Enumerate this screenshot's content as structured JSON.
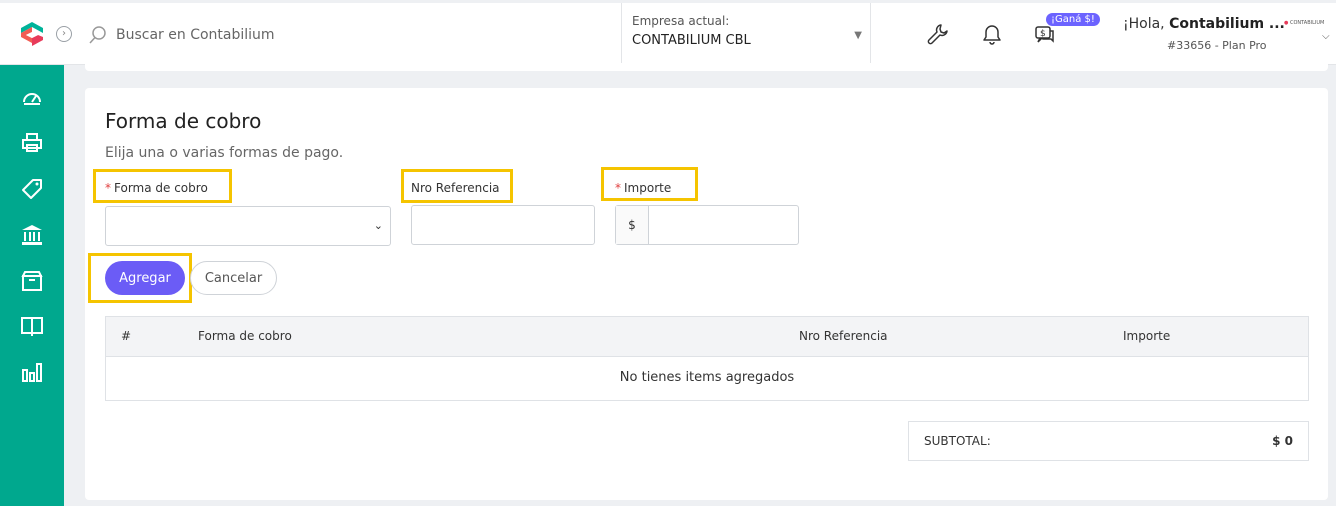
{
  "header": {
    "search_placeholder": "Buscar en Contabilium",
    "company_label": "Empresa actual:",
    "company_value": "CONTABILIUM CBL",
    "badge": "¡Ganá $!",
    "greeting_prefix": "¡Hola, ",
    "greeting_name": "Contabilium ...",
    "plan": "#33656 - Plan Pro",
    "avatar_text": "CONTABILIUM"
  },
  "colors": {
    "sidebar": "#00a88e",
    "primary_button": "#6b5cf6",
    "highlight": "#f5c400",
    "required": "#e03e3e"
  },
  "sidebar": {
    "items": [
      {
        "icon": "dashboard-icon"
      },
      {
        "icon": "printer-icon"
      },
      {
        "icon": "tag-icon"
      },
      {
        "icon": "bank-icon"
      },
      {
        "icon": "box-icon"
      },
      {
        "icon": "book-icon"
      },
      {
        "icon": "bar-chart-icon"
      }
    ]
  },
  "form": {
    "title": "Forma de cobro",
    "subtitle": "Elija una o varias formas de pago.",
    "payment_method_label": "Forma de cobro",
    "reference_label": "Nro Referencia",
    "amount_label": "Importe",
    "currency_symbol": "$",
    "required_mark": "*",
    "add_button": "Agregar",
    "cancel_button": "Cancelar"
  },
  "table": {
    "columns": [
      "#",
      "Forma de cobro",
      "Nro Referencia",
      "Importe"
    ],
    "empty_message": "No tienes items agregados"
  },
  "totals": {
    "subtotal_label": "SUBTOTAL:",
    "subtotal_value": "$ 0"
  }
}
